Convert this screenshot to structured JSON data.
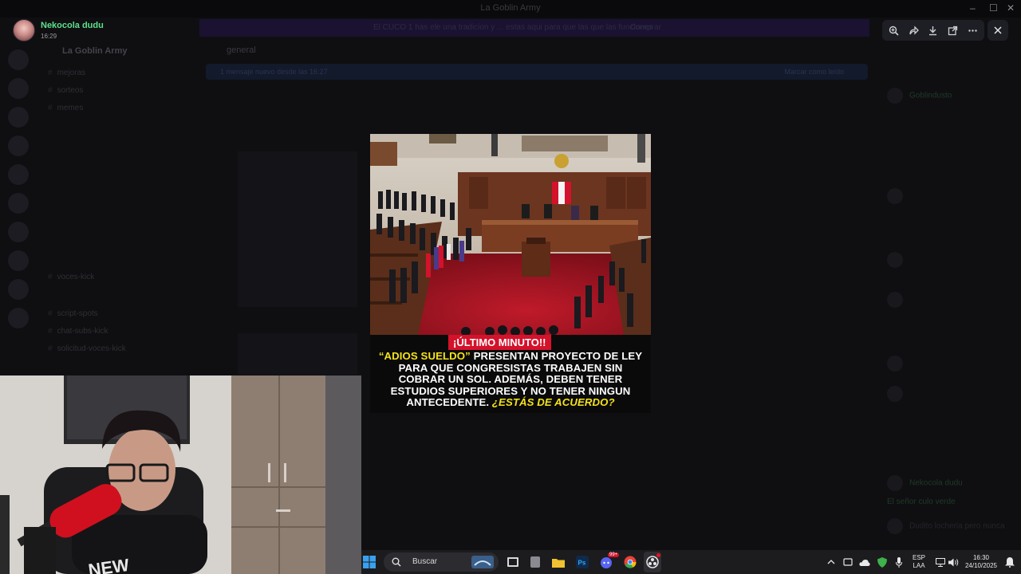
{
  "window": {
    "title": "La Goblin Army"
  },
  "banner": {
    "text": "El CUCO 1 has ele una tradicion y ... estas aqui para que las que las funciones",
    "button": "Comprar"
  },
  "server": {
    "name": "La Goblin Army"
  },
  "channels": [
    {
      "label": "mejoras"
    },
    {
      "label": "sorteos"
    },
    {
      "label": "memes"
    },
    {
      "label": "voces-kick"
    },
    {
      "label": "script-spots"
    },
    {
      "label": "chat-subs-kick"
    },
    {
      "label": "solicitud-voces-kick"
    }
  ],
  "chat": {
    "channel": "general",
    "new_messages": "1 mensaje nuevo desde las 16:27",
    "mark_read": "Marcar como leído"
  },
  "members": [
    {
      "name": "Goblindusto"
    },
    {
      "name": "Nekocola dudu"
    },
    {
      "name": "El señor culo verde"
    },
    {
      "name": "Dudito locheria pero nunca"
    }
  ],
  "viewer": {
    "user_name": "Nekocola dudu",
    "time": "16:29",
    "tools": [
      {
        "name": "zoom-icon"
      },
      {
        "name": "forward-icon"
      },
      {
        "name": "download-icon"
      },
      {
        "name": "open-external-icon"
      },
      {
        "name": "more-icon"
      }
    ]
  },
  "media": {
    "tag": "¡ÚLTIMO MINUTO!!",
    "headline_quote": "“ADIOS SUELDO”",
    "headline_body": "PRESENTAN PROYECTO DE LEY PARA QUE CONGRESISTAS TRABAJEN SIN COBRAR UN SOL. ADEMÁS, DEBEN TENER ESTUDIOS SUPERIORES Y NO TENER NINGUN ANTECEDENTE.",
    "headline_question": "¿ESTÁS DE ACUERDO?",
    "accent_color": "#f4e21b",
    "tag_color": "#d4122b"
  },
  "taskbar": {
    "search_placeholder": "Buscar",
    "language": "ESP",
    "layout": "LAA",
    "time": "16:30",
    "date": "24/10/2025",
    "discord_badge": "99+"
  }
}
